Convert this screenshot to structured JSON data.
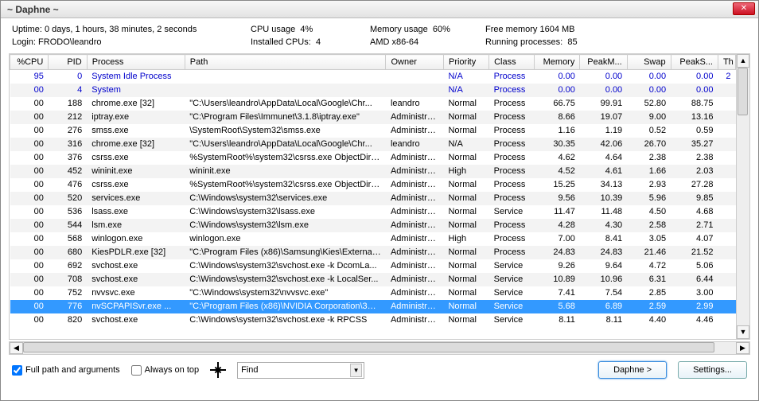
{
  "window": {
    "title": "~ Daphne ~"
  },
  "info": {
    "uptime_label": "Uptime:",
    "uptime": "0 days, 1 hours, 38 minutes, 2 seconds",
    "cpu_label": "CPU usage",
    "cpu": "4%",
    "mem_label": "Memory usage",
    "mem": "60%",
    "free_label": "Free memory",
    "free": "1604 MB",
    "login_label": "Login:",
    "login": "FRODO\\leandro",
    "cpus_label": "Installed CPUs:",
    "cpus": "4",
    "arch": "AMD x86-64",
    "running_label": "Running processes:",
    "running": "85"
  },
  "columns": [
    "%CPU",
    "PID",
    "Process",
    "Path",
    "Owner",
    "Priority",
    "Class",
    "Memory",
    "PeakM...",
    "Swap",
    "PeakS...",
    "Th"
  ],
  "rows": [
    {
      "cpu": "95",
      "pid": "0",
      "proc": "System Idle Process",
      "path": "",
      "owner": "",
      "prio": "N/A",
      "class": "Process",
      "mem": "0.00",
      "peak": "0.00",
      "swap": "0.00",
      "peaks": "0.00",
      "th": "2",
      "sys": true
    },
    {
      "cpu": "00",
      "pid": "4",
      "proc": "System",
      "path": "",
      "owner": "",
      "prio": "N/A",
      "class": "Process",
      "mem": "0.00",
      "peak": "0.00",
      "swap": "0.00",
      "peaks": "0.00",
      "th": "",
      "sys": true
    },
    {
      "cpu": "00",
      "pid": "188",
      "proc": "chrome.exe [32]",
      "path": "\"C:\\Users\\leandro\\AppData\\Local\\Google\\Chr...",
      "owner": "leandro",
      "prio": "Normal",
      "class": "Process",
      "mem": "66.75",
      "peak": "99.91",
      "swap": "52.80",
      "peaks": "88.75",
      "th": ""
    },
    {
      "cpu": "00",
      "pid": "212",
      "proc": "iptray.exe",
      "path": "\"C:\\Program Files\\Immunet\\3.1.8\\iptray.exe\"",
      "owner": "Administrat...",
      "prio": "Normal",
      "class": "Process",
      "mem": "8.66",
      "peak": "19.07",
      "swap": "9.00",
      "peaks": "13.16",
      "th": ""
    },
    {
      "cpu": "00",
      "pid": "276",
      "proc": "smss.exe",
      "path": "\\SystemRoot\\System32\\smss.exe",
      "owner": "Administrat...",
      "prio": "Normal",
      "class": "Process",
      "mem": "1.16",
      "peak": "1.19",
      "swap": "0.52",
      "peaks": "0.59",
      "th": ""
    },
    {
      "cpu": "00",
      "pid": "316",
      "proc": "chrome.exe [32]",
      "path": "\"C:\\Users\\leandro\\AppData\\Local\\Google\\Chr...",
      "owner": "leandro",
      "prio": "N/A",
      "class": "Process",
      "mem": "30.35",
      "peak": "42.06",
      "swap": "26.70",
      "peaks": "35.27",
      "th": ""
    },
    {
      "cpu": "00",
      "pid": "376",
      "proc": "csrss.exe",
      "path": "%SystemRoot%\\system32\\csrss.exe ObjectDire...",
      "owner": "Administrat...",
      "prio": "Normal",
      "class": "Process",
      "mem": "4.62",
      "peak": "4.64",
      "swap": "2.38",
      "peaks": "2.38",
      "th": ""
    },
    {
      "cpu": "00",
      "pid": "452",
      "proc": "wininit.exe",
      "path": "wininit.exe",
      "owner": "Administrat...",
      "prio": "High",
      "class": "Process",
      "mem": "4.52",
      "peak": "4.61",
      "swap": "1.66",
      "peaks": "2.03",
      "th": ""
    },
    {
      "cpu": "00",
      "pid": "476",
      "proc": "csrss.exe",
      "path": "%SystemRoot%\\system32\\csrss.exe ObjectDire...",
      "owner": "Administrat...",
      "prio": "Normal",
      "class": "Process",
      "mem": "15.25",
      "peak": "34.13",
      "swap": "2.93",
      "peaks": "27.28",
      "th": ""
    },
    {
      "cpu": "00",
      "pid": "520",
      "proc": "services.exe",
      "path": "C:\\Windows\\system32\\services.exe",
      "owner": "Administrat...",
      "prio": "Normal",
      "class": "Process",
      "mem": "9.56",
      "peak": "10.39",
      "swap": "5.96",
      "peaks": "9.85",
      "th": ""
    },
    {
      "cpu": "00",
      "pid": "536",
      "proc": "lsass.exe",
      "path": "C:\\Windows\\system32\\lsass.exe",
      "owner": "Administrat...",
      "prio": "Normal",
      "class": "Service",
      "mem": "11.47",
      "peak": "11.48",
      "swap": "4.50",
      "peaks": "4.68",
      "th": ""
    },
    {
      "cpu": "00",
      "pid": "544",
      "proc": "lsm.exe",
      "path": "C:\\Windows\\system32\\lsm.exe",
      "owner": "Administrat...",
      "prio": "Normal",
      "class": "Process",
      "mem": "4.28",
      "peak": "4.30",
      "swap": "2.58",
      "peaks": "2.71",
      "th": ""
    },
    {
      "cpu": "00",
      "pid": "568",
      "proc": "winlogon.exe",
      "path": "winlogon.exe",
      "owner": "Administrat...",
      "prio": "High",
      "class": "Process",
      "mem": "7.00",
      "peak": "8.41",
      "swap": "3.05",
      "peaks": "4.07",
      "th": ""
    },
    {
      "cpu": "00",
      "pid": "680",
      "proc": "KiesPDLR.exe [32]",
      "path": "\"C:\\Program Files (x86)\\Samsung\\Kies\\External...",
      "owner": "Administrat...",
      "prio": "Normal",
      "class": "Process",
      "mem": "24.83",
      "peak": "24.83",
      "swap": "21.46",
      "peaks": "21.52",
      "th": ""
    },
    {
      "cpu": "00",
      "pid": "692",
      "proc": "svchost.exe",
      "path": "C:\\Windows\\system32\\svchost.exe -k DcomLa...",
      "owner": "Administrat...",
      "prio": "Normal",
      "class": "Service",
      "mem": "9.26",
      "peak": "9.64",
      "swap": "4.72",
      "peaks": "5.06",
      "th": ""
    },
    {
      "cpu": "00",
      "pid": "708",
      "proc": "svchost.exe",
      "path": "C:\\Windows\\system32\\svchost.exe -k LocalSer...",
      "owner": "Administrat...",
      "prio": "Normal",
      "class": "Service",
      "mem": "10.89",
      "peak": "10.96",
      "swap": "6.31",
      "peaks": "6.44",
      "th": ""
    },
    {
      "cpu": "00",
      "pid": "752",
      "proc": "nvvsvc.exe",
      "path": "\"C:\\Windows\\system32\\nvvsvc.exe\"",
      "owner": "Administrat...",
      "prio": "Normal",
      "class": "Service",
      "mem": "7.41",
      "peak": "7.54",
      "swap": "2.85",
      "peaks": "3.00",
      "th": ""
    },
    {
      "cpu": "00",
      "pid": "776",
      "proc": "nvSCPAPISvr.exe ...",
      "path": "\"C:\\Program Files (x86)\\NVIDIA Corporation\\3D ...",
      "owner": "Administrat...",
      "prio": "Normal",
      "class": "Service",
      "mem": "5.68",
      "peak": "6.89",
      "swap": "2.59",
      "peaks": "2.99",
      "th": "",
      "sel": true
    },
    {
      "cpu": "00",
      "pid": "820",
      "proc": "svchost.exe",
      "path": "C:\\Windows\\system32\\svchost.exe -k RPCSS",
      "owner": "Administrat...",
      "prio": "Normal",
      "class": "Service",
      "mem": "8.11",
      "peak": "8.11",
      "swap": "4.40",
      "peaks": "4.46",
      "th": ""
    }
  ],
  "bottom": {
    "fullpath": "Full path and arguments",
    "ontop": "Always on top",
    "find": "Find",
    "daphne": "Daphne >",
    "settings": "Settings..."
  }
}
